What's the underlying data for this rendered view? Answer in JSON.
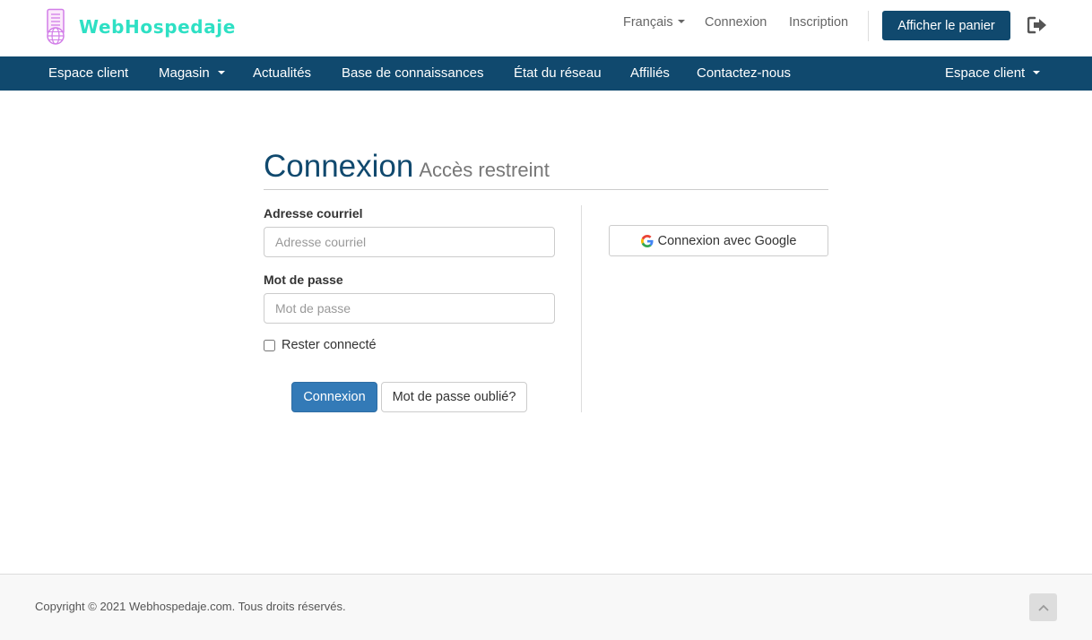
{
  "header": {
    "brand_name": "WebHospedaje",
    "language_label": "Français",
    "login_link": "Connexion",
    "register_link": "Inscription",
    "cart_button": "Afficher le panier",
    "logout_icon": "sign-out-icon"
  },
  "nav": {
    "items": [
      {
        "label": "Espace client",
        "has_dropdown": false
      },
      {
        "label": "Magasin",
        "has_dropdown": true
      },
      {
        "label": "Actualités",
        "has_dropdown": false
      },
      {
        "label": "Base de connaissances",
        "has_dropdown": false
      },
      {
        "label": "État du réseau",
        "has_dropdown": false
      },
      {
        "label": "Affiliés",
        "has_dropdown": false
      },
      {
        "label": "Contactez-nous",
        "has_dropdown": false
      }
    ],
    "account_menu": "Espace client"
  },
  "login": {
    "title": "Connexion",
    "subtitle": "Accès restreint",
    "email_label": "Adresse courriel",
    "email_placeholder": "Adresse courriel",
    "email_value": "",
    "password_label": "Mot de passe",
    "password_placeholder": "Mot de passe",
    "password_value": "",
    "remember_label": "Rester connecté",
    "remember_checked": false,
    "submit_button": "Connexion",
    "forgot_button": "Mot de passe oublié?",
    "google_button": "Connexion avec Google"
  },
  "footer": {
    "copyright": "Copyright © 2021 Webhospedaje.com. Tous droits réservés."
  },
  "colors": {
    "brand": "#10496e",
    "accent": "#2ee0c4",
    "primary_button": "#337ab7"
  }
}
